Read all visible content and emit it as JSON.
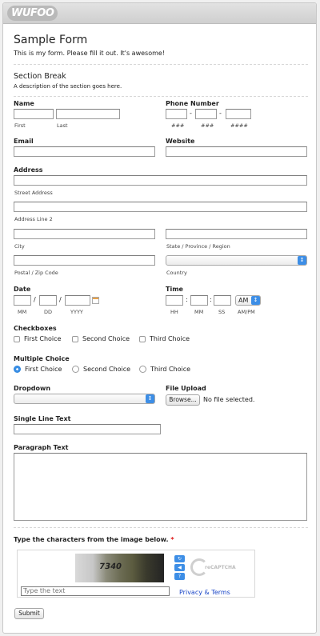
{
  "app": {
    "logo": "WUFOO"
  },
  "form": {
    "title": "Sample Form",
    "description": "This is my form. Please fill it out. It's awesome!",
    "section_title": "Section Break",
    "section_desc": "A description of the section goes here."
  },
  "name": {
    "label": "Name",
    "first": "First",
    "last": "Last"
  },
  "phone": {
    "label": "Phone Number",
    "sep": "-",
    "sub1": "###",
    "sub2": "###",
    "sub3": "####"
  },
  "email": {
    "label": "Email"
  },
  "website": {
    "label": "Website"
  },
  "address": {
    "label": "Address",
    "street": "Street Address",
    "line2": "Address Line 2",
    "city": "City",
    "state": "State / Province / Region",
    "postal": "Postal / Zip Code",
    "country": "Country"
  },
  "date": {
    "label": "Date",
    "sep": "/",
    "mm": "MM",
    "dd": "DD",
    "yyyy": "YYYY"
  },
  "time": {
    "label": "Time",
    "sep": ":",
    "ampm_value": "AM",
    "hh": "HH",
    "mm": "MM",
    "ss": "SS",
    "ampm": "AM/PM"
  },
  "checkboxes": {
    "label": "Checkboxes",
    "options": [
      "First Choice",
      "Second Choice",
      "Third Choice"
    ]
  },
  "multiple": {
    "label": "Multiple Choice",
    "options": [
      "First Choice",
      "Second Choice",
      "Third Choice"
    ],
    "selected": 0
  },
  "dropdown": {
    "label": "Dropdown"
  },
  "upload": {
    "label": "File Upload",
    "browse": "Browse...",
    "status": "No file selected."
  },
  "single": {
    "label": "Single Line Text"
  },
  "paragraph": {
    "label": "Paragraph Text"
  },
  "captcha": {
    "label": "Type the characters from the image below.",
    "required_mark": "*",
    "image_text": "7340",
    "placeholder": "Type the text",
    "privacy": "Privacy & Terms",
    "logo_text": "reCAPTCHA"
  },
  "submit": {
    "label": "Submit"
  },
  "colors": {
    "accent": "#3d8ee6",
    "link": "#1a46c7",
    "required": "#dd1111"
  }
}
